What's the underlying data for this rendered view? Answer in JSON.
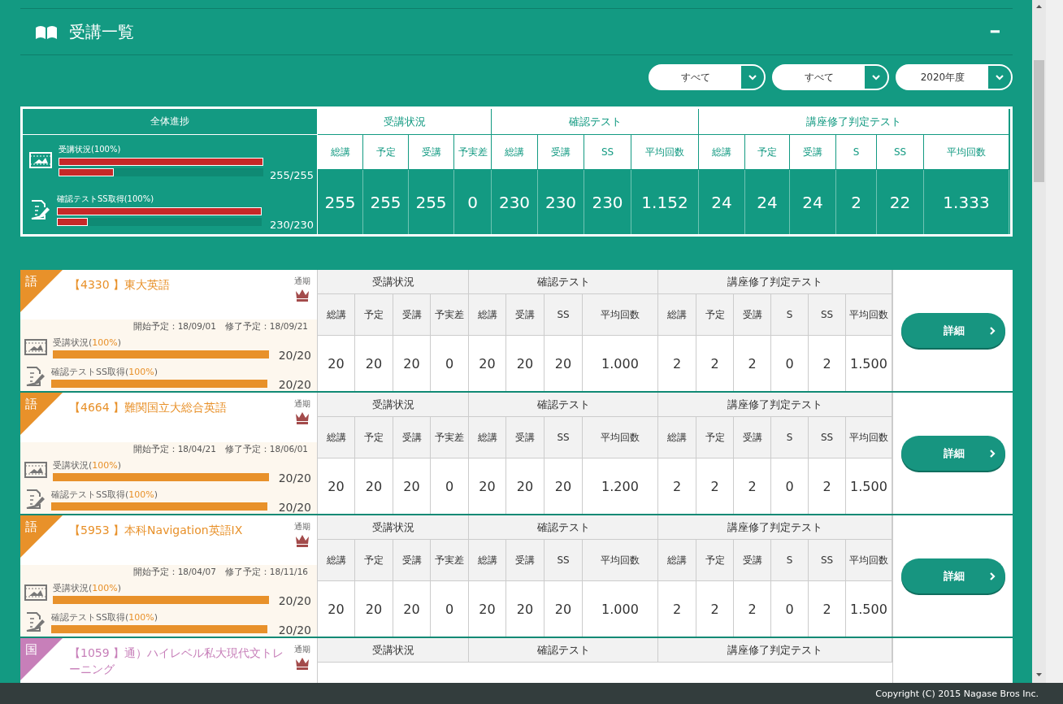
{
  "header": {
    "title": "受講一覧",
    "collapse": "━"
  },
  "filters": [
    {
      "value": "すべて"
    },
    {
      "value": "すべて"
    },
    {
      "value": "2020年度"
    }
  ],
  "summary": {
    "title": "全体進捗",
    "progress": [
      {
        "kind": "video",
        "label": "受講状況(100%)",
        "bars": [
          {
            "level": 1
          },
          {
            "level": 0.27
          }
        ],
        "reading": "255/255"
      },
      {
        "kind": "test",
        "label": "確認テストSS取得(100%)",
        "bars": [
          {
            "level": 1
          },
          {
            "level": 0.15
          }
        ],
        "reading": "230/230"
      }
    ],
    "groups": [
      {
        "title": "受講状況",
        "columns": [
          "総講",
          "予定",
          "受講",
          "予実差"
        ],
        "values": [
          "255",
          "255",
          "255",
          "0"
        ]
      },
      {
        "title": "確認テスト",
        "columns": [
          "総講",
          "受講",
          "SS",
          "平均回数"
        ],
        "values": [
          "230",
          "230",
          "230",
          "1.152"
        ]
      },
      {
        "title": "講座修了判定テスト",
        "columns": [
          "総講",
          "予定",
          "受講",
          "S",
          "SS",
          "平均回数"
        ],
        "values": [
          "24",
          "24",
          "24",
          "2",
          "22",
          "1.333"
        ]
      }
    ]
  },
  "courses": [
    {
      "subject": "語",
      "color": "#e8912a",
      "title": "【4330 】東大英語",
      "term": "通期",
      "dates": "開始予定：18/09/01　修了予定：18/09/21",
      "progress": [
        {
          "kind": "video",
          "pre": "受講状況(",
          "pct": "100%",
          "post": ")",
          "level": 1,
          "reading": "20/20"
        },
        {
          "kind": "test",
          "pre": "確認テストSS取得(",
          "pct": "100%",
          "post": ")",
          "level": 1,
          "reading": "20/20"
        }
      ],
      "groups": [
        {
          "title": "受講状況",
          "columns": [
            "総講",
            "予定",
            "受講",
            "予実差"
          ],
          "values": [
            "20",
            "20",
            "20",
            "0"
          ]
        },
        {
          "title": "確認テスト",
          "columns": [
            "総講",
            "受講",
            "SS",
            "平均回数"
          ],
          "values": [
            "20",
            "20",
            "20",
            "1.000"
          ]
        },
        {
          "title": "講座修了判定テスト",
          "columns": [
            "総講",
            "予定",
            "受講",
            "S",
            "SS",
            "平均回数"
          ],
          "values": [
            "2",
            "2",
            "2",
            "0",
            "2",
            "1.500"
          ]
        }
      ],
      "button": "詳細"
    },
    {
      "subject": "語",
      "color": "#e8912a",
      "title": "【4664 】難関国立大総合英語",
      "term": "通期",
      "dates": "開始予定：18/04/21　修了予定：18/06/01",
      "progress": [
        {
          "kind": "video",
          "pre": "受講状況(",
          "pct": "100%",
          "post": ")",
          "level": 1,
          "reading": "20/20"
        },
        {
          "kind": "test",
          "pre": "確認テストSS取得(",
          "pct": "100%",
          "post": ")",
          "level": 1,
          "reading": "20/20"
        }
      ],
      "groups": [
        {
          "title": "受講状況",
          "columns": [
            "総講",
            "予定",
            "受講",
            "予実差"
          ],
          "values": [
            "20",
            "20",
            "20",
            "0"
          ]
        },
        {
          "title": "確認テスト",
          "columns": [
            "総講",
            "受講",
            "SS",
            "平均回数"
          ],
          "values": [
            "20",
            "20",
            "20",
            "1.200"
          ]
        },
        {
          "title": "講座修了判定テスト",
          "columns": [
            "総講",
            "予定",
            "受講",
            "S",
            "SS",
            "平均回数"
          ],
          "values": [
            "2",
            "2",
            "2",
            "0",
            "2",
            "1.500"
          ]
        }
      ],
      "button": "詳細"
    },
    {
      "subject": "語",
      "color": "#e8912a",
      "title": "【5953 】本科Navigation英語IX",
      "term": "通期",
      "dates": "開始予定：18/04/07　修了予定：18/11/16",
      "progress": [
        {
          "kind": "video",
          "pre": "受講状況(",
          "pct": "100%",
          "post": ")",
          "level": 1,
          "reading": "20/20"
        },
        {
          "kind": "test",
          "pre": "確認テストSS取得(",
          "pct": "100%",
          "post": ")",
          "level": 1,
          "reading": "20/20"
        }
      ],
      "groups": [
        {
          "title": "受講状況",
          "columns": [
            "総講",
            "予定",
            "受講",
            "予実差"
          ],
          "values": [
            "20",
            "20",
            "20",
            "0"
          ]
        },
        {
          "title": "確認テスト",
          "columns": [
            "総講",
            "受講",
            "SS",
            "平均回数"
          ],
          "values": [
            "20",
            "20",
            "20",
            "1.000"
          ]
        },
        {
          "title": "講座修了判定テスト",
          "columns": [
            "総講",
            "予定",
            "受講",
            "S",
            "SS",
            "平均回数"
          ],
          "values": [
            "2",
            "2",
            "2",
            "0",
            "2",
            "1.500"
          ]
        }
      ],
      "button": "詳細"
    },
    {
      "subject": "国",
      "color": "#c77fb9",
      "title": "【1059 】通）ハイレベル私大現代文トレーニング",
      "term": "通期",
      "groups": [
        {
          "title": "受講状況"
        },
        {
          "title": "確認テスト"
        },
        {
          "title": "講座修了判定テスト"
        }
      ]
    }
  ],
  "footer": "Copyright (C) 2015 Nagase Bros Inc."
}
